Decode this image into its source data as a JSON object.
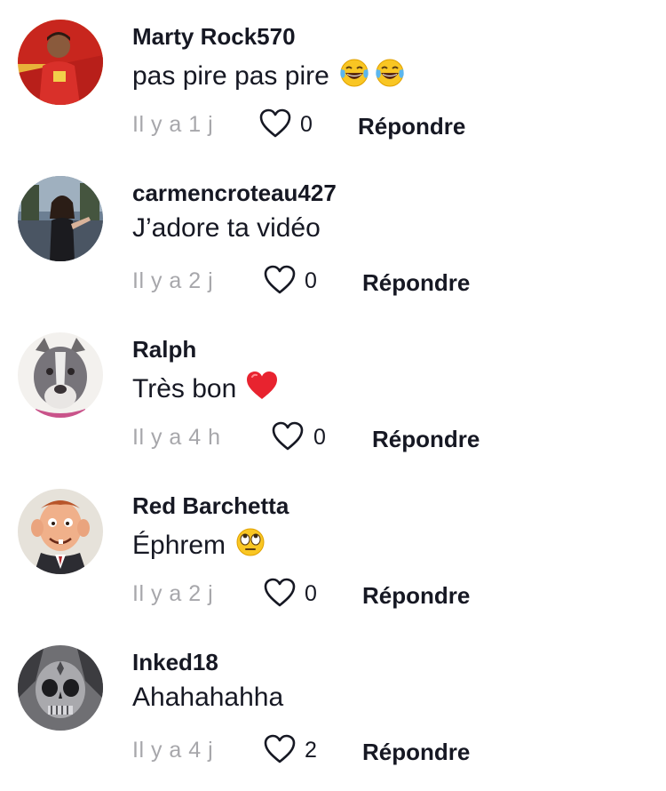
{
  "comments": [
    {
      "username": "Marty Rock570",
      "text": "pas pire pas pire",
      "emojis": [
        "laughing-tears-emoji",
        "laughing-tears-emoji"
      ],
      "time": "Il y a 1 j",
      "likes": "0",
      "reply_label": "Répondre"
    },
    {
      "username": "carmencroteau427",
      "text": "J’adore ta vidéo",
      "emojis": [],
      "time": "Il y a 2 j",
      "likes": "0",
      "reply_label": "Répondre"
    },
    {
      "username": "Ralph",
      "text": "Très bon",
      "emojis": [
        "red-heart-emoji"
      ],
      "time": "Il y a 4 h",
      "likes": "0",
      "reply_label": "Répondre"
    },
    {
      "username": "Red Barchetta",
      "text": "Éphrem",
      "emojis": [
        "eye-roll-emoji"
      ],
      "time": "Il y a 2 j",
      "likes": "0",
      "reply_label": "Répondre"
    },
    {
      "username": "Inked18",
      "text": "Ahahahahha",
      "emojis": [],
      "time": "Il y a 4 j",
      "likes": "2",
      "reply_label": "Répondre"
    }
  ],
  "colors": {
    "text_primary": "#161823",
    "text_secondary": "#a7a7ab",
    "heart_outline": "#161823"
  }
}
